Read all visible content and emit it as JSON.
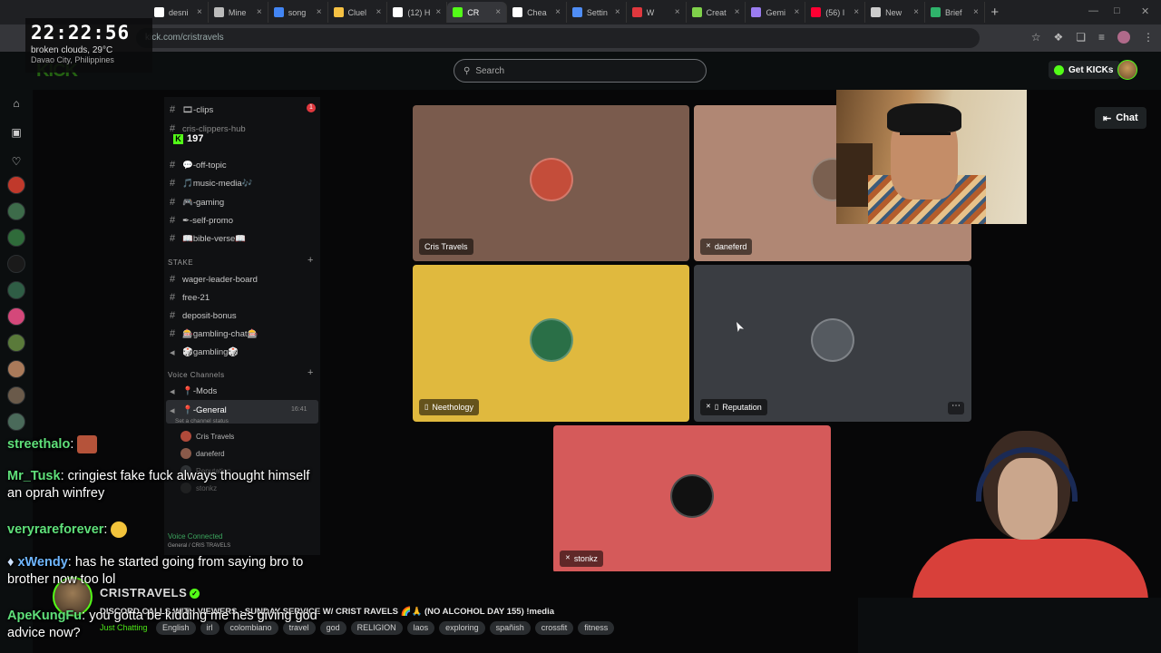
{
  "browser": {
    "tabs": [
      {
        "label": "desni",
        "color": "#ffffff"
      },
      {
        "label": "Mine",
        "color": "#bbbbbb"
      },
      {
        "label": "song",
        "color": "#4285f4"
      },
      {
        "label": "Cluel",
        "color": "#f6c143"
      },
      {
        "label": "(12) H",
        "color": "#ffffff"
      },
      {
        "label": "CR",
        "color": "#53fc18"
      },
      {
        "label": "Chea",
        "color": "#ffffff"
      },
      {
        "label": "Settin",
        "color": "#4f8df5"
      },
      {
        "label": "W",
        "color": "#e0383e"
      },
      {
        "label": "Creat",
        "color": "#7fd14a"
      },
      {
        "label": "Gemi",
        "color": "#9a7cf0"
      },
      {
        "label": "(56) I",
        "color": "#ff0033"
      },
      {
        "label": "New",
        "color": "#cccccc"
      },
      {
        "label": "Brief",
        "color": "#2fb36b"
      }
    ],
    "url": "kick.com/cristravels"
  },
  "clock": {
    "time": "22:22:56",
    "weather": "broken clouds, 29°C",
    "city": "Davao City, Philippines"
  },
  "kick": {
    "search_placeholder": "Search",
    "get_kicks_label": "Get KICKs",
    "chat_label": "Chat",
    "viewer_count": "197"
  },
  "discord": {
    "channels": [
      {
        "label": "🎞-clips"
      },
      {
        "label": "cris-clippers-hub"
      },
      {
        "label": "💬-off-topic"
      },
      {
        "label": "🎵music-media🎶"
      },
      {
        "label": "🎮-gaming"
      },
      {
        "label": "✒-self-promo"
      },
      {
        "label": "📖bible-verse📖"
      }
    ],
    "category_stake": "STAKE",
    "stake_channels": [
      {
        "label": "wager-leader-board"
      },
      {
        "label": "free-21"
      },
      {
        "label": "deposit-bonus"
      },
      {
        "label": "🎰gambling-chat🎰"
      },
      {
        "label": "🎲gambling🎲"
      }
    ],
    "category_voice": "Voice Channels",
    "voice_channels": [
      {
        "label": "📍-Mods"
      },
      {
        "label": "📍-General",
        "time": "16:41",
        "status": "Set a channel status"
      }
    ],
    "voice_users": [
      "Cris Travels",
      "daneferd",
      "Reputation",
      "stonkz"
    ],
    "connected_label": "Voice Connected",
    "connected_sub": "General / CRIS TRAVELS"
  },
  "video_tiles": [
    {
      "name": "Cris Travels",
      "bg": "#7a5b4d",
      "av": "#c44d3a"
    },
    {
      "name": "daneferd",
      "bg": "#b08774",
      "av": "#7a6050"
    },
    {
      "name": "Neethology",
      "bg": "#e0b93e",
      "av": "#2a6f47"
    },
    {
      "name": "Reputation",
      "bg": "#3a3d42",
      "av": "#555a60"
    },
    {
      "name": "stonkz",
      "bg": "#d55a5a",
      "av": "#111111"
    }
  ],
  "stream_info": {
    "streamer": "CRISTRAVELS",
    "title": "DISCORD CALLS WITH VIEWERS - SUNDAY SERVICE W/ CRIST RAVELS 🌈🙏 (NO ALCOHOL DAY 155) !media",
    "category": "Just Chatting",
    "tags": [
      "English",
      "irl",
      "colombiano",
      "travel",
      "god",
      "RELIGION",
      "laos",
      "exploring",
      "spañish",
      "crossfit",
      "fitness"
    ]
  },
  "chat": [
    {
      "user": "streethalo",
      "color": "#5fe07a",
      "text": ""
    },
    {
      "user": "Mr_Tusk",
      "color": "#5fe07a",
      "text": "cringiest fake fuck always thought himself an oprah winfrey"
    },
    {
      "user": "veryrareforever",
      "color": "#5fe07a",
      "text": ""
    },
    {
      "user": "xWendy",
      "color": "#6fb6ff",
      "text": "has he started going from saying bro to brother now too lol"
    },
    {
      "user": "ApeKungFu",
      "color": "#5fe07a",
      "text": "you gotta be kidding me hes giving god advice now?"
    }
  ]
}
